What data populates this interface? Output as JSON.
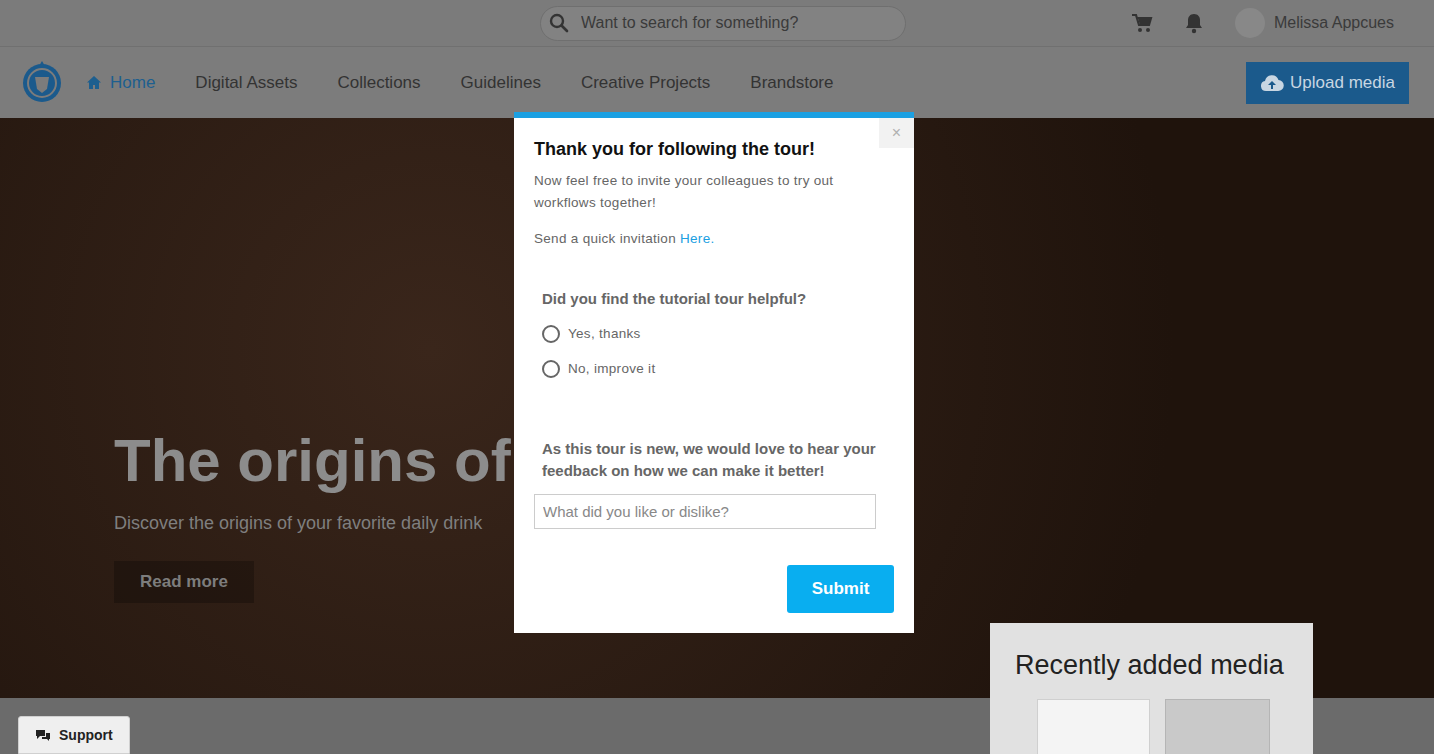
{
  "top_bar": {
    "search": {
      "placeholder": "Want to search for something?"
    },
    "user": {
      "name": "Melissa Appcues"
    }
  },
  "nav": {
    "items": [
      {
        "label": "Home",
        "selected": true
      },
      {
        "label": "Digital Assets",
        "selected": false
      },
      {
        "label": "Collections",
        "selected": false
      },
      {
        "label": "Guidelines",
        "selected": false
      },
      {
        "label": "Creative Projects",
        "selected": false
      },
      {
        "label": "Brandstore",
        "selected": false
      }
    ],
    "upload_button": "Upload media"
  },
  "hero": {
    "title": "The origins of c",
    "subtitle": "Discover the origins of your favorite daily drink",
    "button": "Read more"
  },
  "recent_media": {
    "title": "Recently added media"
  },
  "support": {
    "label": "Support"
  },
  "modal": {
    "close": "×",
    "title": "Thank you for following the tour!",
    "body": "Now feel free to invite your colleagues to try out workflows together!",
    "invite_text": "Send a quick invitation",
    "invite_link": "Here.",
    "question": "Did you find the tutorial tour helpful?",
    "options": [
      {
        "label": "Yes, thanks",
        "selected": false
      },
      {
        "label": "No, improve it",
        "selected": false
      }
    ],
    "feedback_title": "As this tour is new, we would love to hear your feedback on how we can make it better!",
    "feedback_placeholder": "What did you like or dislike?",
    "submit": "Submit"
  }
}
